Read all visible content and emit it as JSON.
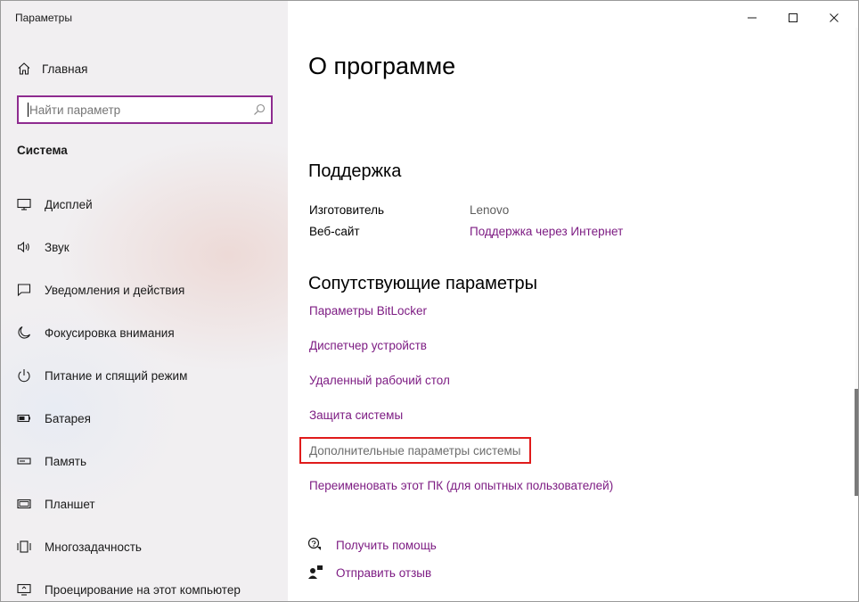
{
  "window": {
    "title": "Параметры"
  },
  "sidebar": {
    "home_label": "Главная",
    "search_placeholder": "Найти параметр",
    "section_title": "Система",
    "items": [
      {
        "label": "Дисплей",
        "icon": "monitor-icon"
      },
      {
        "label": "Звук",
        "icon": "speaker-icon"
      },
      {
        "label": "Уведомления и действия",
        "icon": "notification-icon"
      },
      {
        "label": "Фокусировка внимания",
        "icon": "moon-icon"
      },
      {
        "label": "Питание и спящий режим",
        "icon": "power-icon"
      },
      {
        "label": "Батарея",
        "icon": "battery-icon"
      },
      {
        "label": "Память",
        "icon": "storage-icon"
      },
      {
        "label": "Планшет",
        "icon": "tablet-icon"
      },
      {
        "label": "Многозадачность",
        "icon": "multitasking-icon"
      },
      {
        "label": "Проецирование на этот компьютер",
        "icon": "projection-icon"
      }
    ]
  },
  "main": {
    "title": "О программе",
    "support": {
      "heading": "Поддержка",
      "manufacturer_label": "Изготовитель",
      "manufacturer_value": "Lenovo",
      "website_label": "Веб-сайт",
      "website_value": "Поддержка через Интернет"
    },
    "related": {
      "heading": "Сопутствующие параметры",
      "links": [
        "Параметры BitLocker",
        "Диспетчер устройств",
        "Удаленный рабочий стол",
        "Защита системы",
        "Дополнительные параметры системы",
        "Переименовать этот ПК (для опытных пользователей)"
      ]
    },
    "help": {
      "get_help": "Получить помощь",
      "feedback": "Отправить отзыв"
    }
  },
  "colors": {
    "accent": "#7d1c83",
    "search_border": "#8e2b8f",
    "highlight": "#e01b1b"
  }
}
